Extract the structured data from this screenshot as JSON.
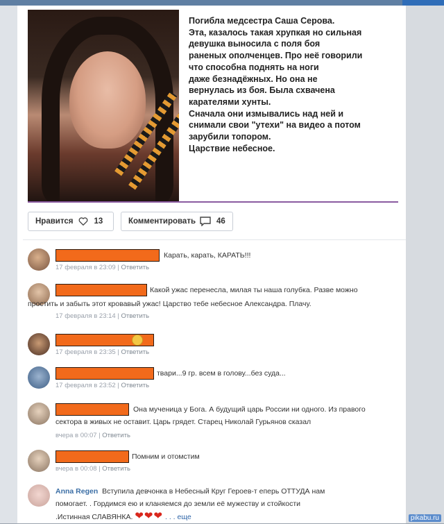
{
  "post": {
    "text_lines": [
      "Погибла медсестра Саша Серова.",
      "Эта, казалось такая хрупкая но сильная",
      "девушка выносила с поля боя",
      "раненых ополченцев. Про неё говорили",
      "что способна поднять на ноги",
      "даже безнадёжных. Но она не",
      "вернулась из боя. Была схвачена",
      "карателями хунты.",
      "Сначала они измывались над ней и",
      "снимали свои \"утехи\" на видео а потом",
      "зарубили топором.",
      "Царствие небесное."
    ],
    "like_label": "Нравится",
    "like_count": "13",
    "comment_label": "Комментировать",
    "comment_count": "46"
  },
  "comments": [
    {
      "text": "Карать, карать, КАРАТЬ!!!",
      "date": "17 февраля в 23:09",
      "reply": "Ответить"
    },
    {
      "text": "Какой ужас перенесла, милая ты наша голубка. Разве можно",
      "text2": "простить и забыть этот кровавый ужас! Царство тебе небесное Александра. Плачу.",
      "date": "17 февраля в 23:14",
      "reply": "Ответить"
    },
    {
      "text": "",
      "date": "17 февраля в 23:35",
      "reply": "Ответить"
    },
    {
      "text": "твари...9 гр. всем в голову...без суда...",
      "date": "17 февраля в 23:52",
      "reply": "Ответить"
    },
    {
      "text": "Она мученица у Бога. А будущий царь России ни одного. Из правого",
      "text2": "сектора в живых не оставит. Царь грядет. Старец Николай Гурьянов сказал",
      "date": "вчера в 00:07",
      "reply": "Ответить"
    },
    {
      "text": "Помним и отомстим",
      "date": "вчера в 00:08",
      "reply": "Ответить"
    },
    {
      "author": "Anna Regen",
      "text": "Вступила девчонка в Небесный Круг Героев-т еперь ОТТУДА нам",
      "text2": "помогает. . Гордимся ею и кланяемся до земли её мужеству и стойкости",
      "text3": ".Истинная СЛАВЯНКА.",
      "hearts": "❤❤❤",
      "more": ". . . еще"
    }
  ],
  "separator": "|",
  "watermark": "pikabu.ru",
  "colors": {
    "redaction": "#f26a1b",
    "divider": "#8a5aa0",
    "link": "#3b6ea5"
  }
}
